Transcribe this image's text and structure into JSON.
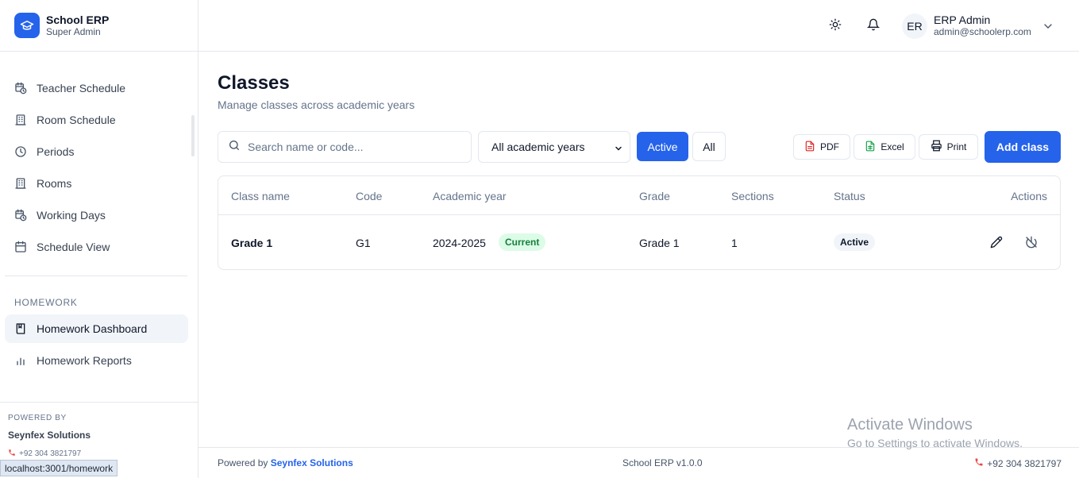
{
  "brand": {
    "title": "School ERP",
    "subtitle": "Super Admin"
  },
  "sidebar": {
    "items": [
      {
        "label": "Teacher Schedule",
        "icon": "calendar-clock-icon"
      },
      {
        "label": "Room Schedule",
        "icon": "building-icon"
      },
      {
        "label": "Periods",
        "icon": "clock-icon"
      },
      {
        "label": "Rooms",
        "icon": "building-icon"
      },
      {
        "label": "Working Days",
        "icon": "calendar-clock-icon"
      },
      {
        "label": "Schedule View",
        "icon": "calendar-icon"
      }
    ],
    "section_label": "HOMEWORK",
    "homework_items": [
      {
        "label": "Homework Dashboard",
        "icon": "book-icon",
        "active": true
      },
      {
        "label": "Homework Reports",
        "icon": "bar-chart-icon"
      }
    ],
    "footer": {
      "powered_by_label": "POWERED BY",
      "company": "Seynfex Solutions",
      "phone": "+92 304 3821797"
    }
  },
  "status_bar_url": "localhost:3001/homework",
  "header": {
    "user": {
      "initials": "ER",
      "name": "ERP Admin",
      "email": "admin@schoolerp.com"
    }
  },
  "page": {
    "title": "Classes",
    "subtitle": "Manage classes across academic years"
  },
  "toolbar": {
    "search_placeholder": "Search name or code...",
    "year_filter": "All academic years",
    "active_label": "Active",
    "all_label": "All",
    "pdf_label": "PDF",
    "excel_label": "Excel",
    "print_label": "Print",
    "add_label": "Add class"
  },
  "table": {
    "headers": {
      "class_name": "Class name",
      "code": "Code",
      "academic_year": "Academic year",
      "grade": "Grade",
      "sections": "Sections",
      "status": "Status",
      "actions": "Actions"
    },
    "rows": [
      {
        "class_name": "Grade 1",
        "code": "G1",
        "academic_year": "2024-2025",
        "year_badge": "Current",
        "grade": "Grade 1",
        "sections": "1",
        "status": "Active"
      }
    ]
  },
  "footer": {
    "powered_prefix": "Powered by",
    "powered_company": "Seynfex Solutions",
    "version": "School ERP v1.0.0",
    "phone": "+92 304 3821797"
  },
  "watermark": {
    "line1": "Activate Windows",
    "line2": "Go to Settings to activate Windows."
  },
  "colors": {
    "primary": "#2563eb",
    "current_badge_bg": "#dcfce7",
    "current_badge_text": "#15803d",
    "phone_icon": "#ef4444"
  }
}
